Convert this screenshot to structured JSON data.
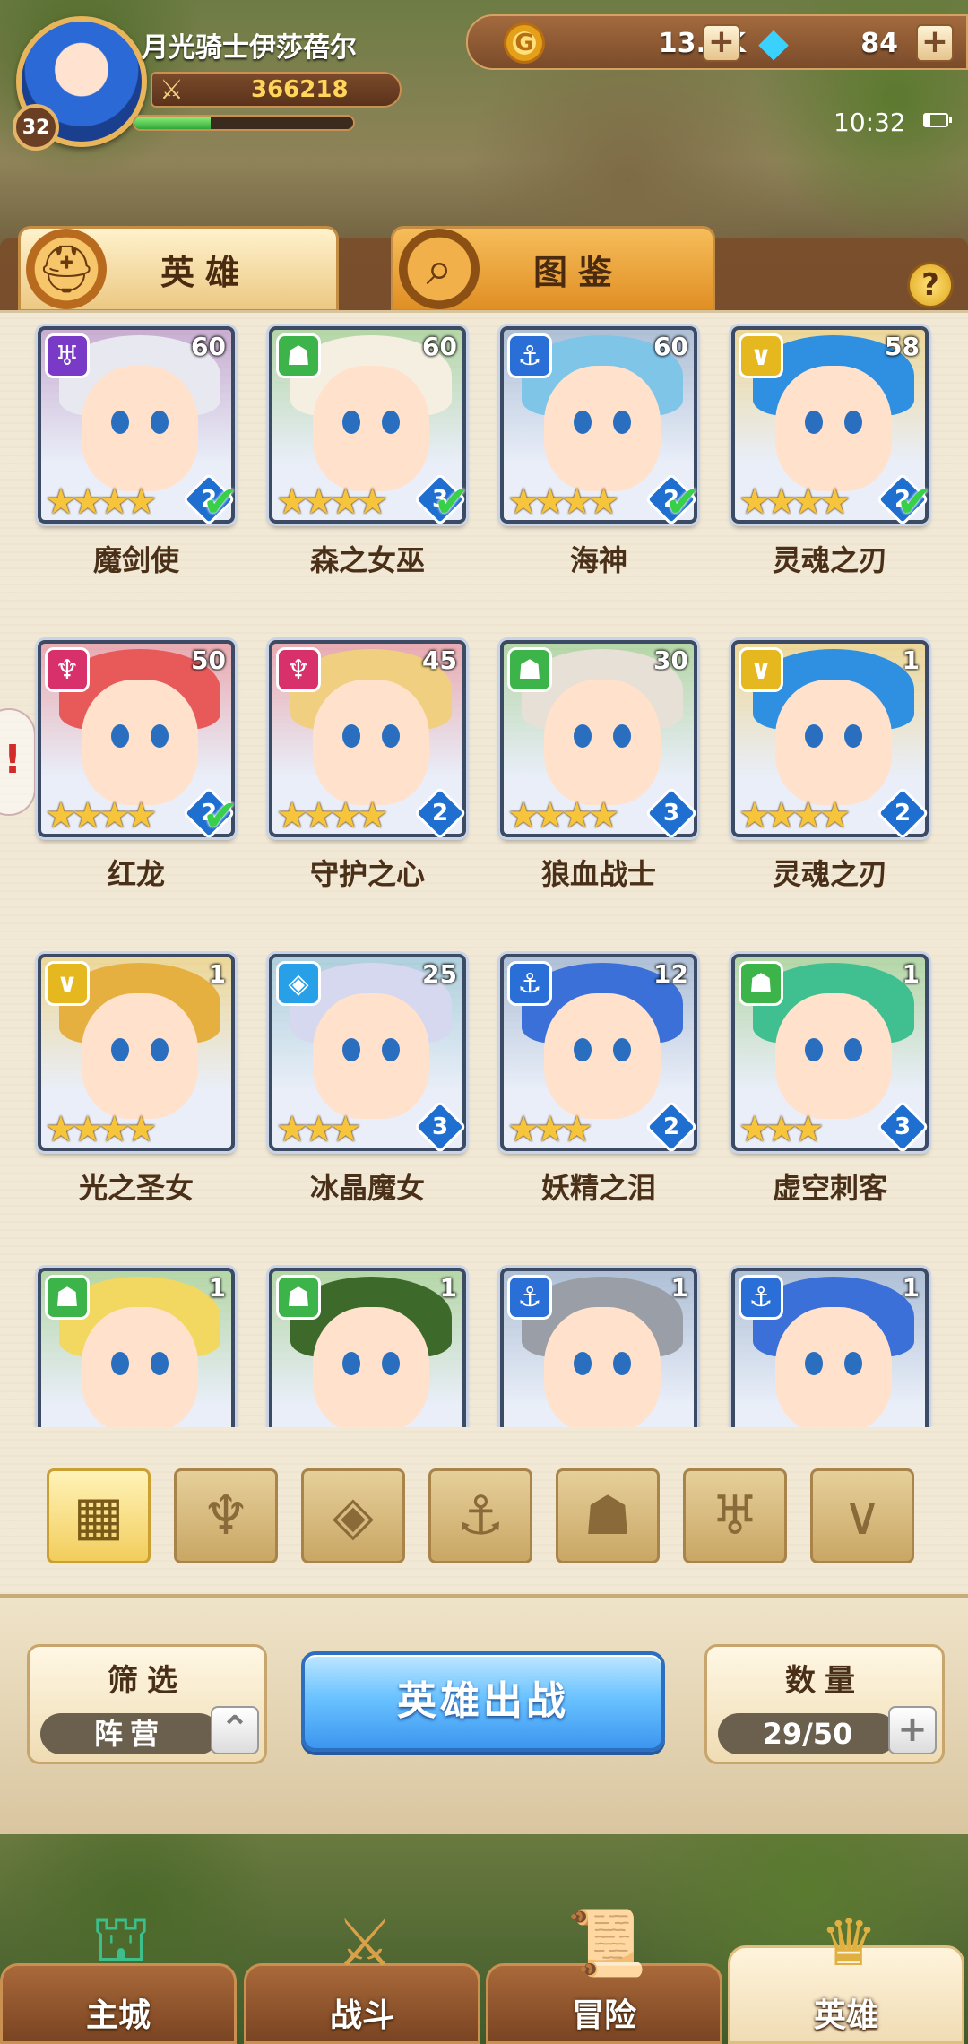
{
  "player": {
    "name": "月光骑士伊莎蓓尔",
    "level": "32",
    "power": "366218",
    "xp_fraction": 0.35
  },
  "currency": {
    "gold": "13.5K",
    "gems": "84"
  },
  "status_bar": {
    "time": "10:32"
  },
  "tabs": [
    {
      "label": "英雄",
      "icon": "knight-helmet-icon"
    },
    {
      "label": "图鉴",
      "icon": "magnifier-book-icon"
    }
  ],
  "help_label": "?",
  "heroes": [
    {
      "name": "魔剑使",
      "level": "60",
      "rank": "2",
      "stars": 4,
      "faction": "dark",
      "faction_color": "#7a3ac8",
      "deployed": true,
      "hair": "#e8e8f0"
    },
    {
      "name": "森之女巫",
      "level": "60",
      "rank": "3",
      "stars": 4,
      "faction": "beast",
      "faction_color": "#3cb44a",
      "deployed": true,
      "hair": "#f4efe0"
    },
    {
      "name": "海神",
      "level": "60",
      "rank": "2",
      "stars": 4,
      "faction": "sea",
      "faction_color": "#2a6fd8",
      "deployed": true,
      "hair": "#7fc5e8"
    },
    {
      "name": "灵魂之刃",
      "level": "58",
      "rank": "2",
      "stars": 4,
      "faction": "light",
      "faction_color": "#e6b820",
      "deployed": true,
      "hair": "#2f8fe0"
    },
    {
      "name": "红龙",
      "level": "50",
      "rank": "2",
      "stars": 4,
      "faction": "fire",
      "faction_color": "#d8306a",
      "deployed": true,
      "hair": "#e85a5a"
    },
    {
      "name": "守护之心",
      "level": "45",
      "rank": "2",
      "stars": 4,
      "faction": "fire",
      "faction_color": "#d8306a",
      "deployed": false,
      "hair": "#f0d080"
    },
    {
      "name": "狼血战士",
      "level": "30",
      "rank": "3",
      "stars": 4,
      "faction": "beast",
      "faction_color": "#3cb44a",
      "deployed": false,
      "hair": "#e6e0d6"
    },
    {
      "name": "灵魂之刃",
      "level": "1",
      "rank": "2",
      "stars": 4,
      "faction": "light",
      "faction_color": "#e6b820",
      "deployed": false,
      "hair": "#2f8fe0"
    },
    {
      "name": "光之圣女",
      "level": "1",
      "rank": "",
      "stars": 4,
      "faction": "light",
      "faction_color": "#e6b820",
      "deployed": false,
      "hair": "#e6b040"
    },
    {
      "name": "冰晶魔女",
      "level": "25",
      "rank": "3",
      "stars": 3,
      "faction": "ice",
      "faction_color": "#28a0e8",
      "deployed": false,
      "hair": "#d6d8f0"
    },
    {
      "name": "妖精之泪",
      "level": "12",
      "rank": "2",
      "stars": 3,
      "faction": "sea",
      "faction_color": "#2a6fd8",
      "deployed": false,
      "hair": "#3a70d8"
    },
    {
      "name": "虚空刺客",
      "level": "1",
      "rank": "3",
      "stars": 3,
      "faction": "beast",
      "faction_color": "#3cb44a",
      "deployed": false,
      "hair": "#40c090"
    },
    {
      "name": "",
      "level": "1",
      "rank": "",
      "stars": 0,
      "faction": "beast",
      "faction_color": "#3cb44a",
      "deployed": false,
      "hair": "#f2d860"
    },
    {
      "name": "",
      "level": "1",
      "rank": "",
      "stars": 0,
      "faction": "beast",
      "faction_color": "#3cb44a",
      "deployed": false,
      "hair": "#3d6a2a"
    },
    {
      "name": "",
      "level": "1",
      "rank": "",
      "stars": 0,
      "faction": "sea",
      "faction_color": "#2a6fd8",
      "deployed": false,
      "hair": "#9a9ea6"
    },
    {
      "name": "",
      "level": "1",
      "rank": "",
      "stars": 0,
      "faction": "sea",
      "faction_color": "#2a6fd8",
      "deployed": false,
      "hair": "#3a70d8"
    }
  ],
  "faction_filters": [
    {
      "icon": "grid-all-icon",
      "glyph": "▦",
      "active": true
    },
    {
      "icon": "fire-faction-icon",
      "glyph": "♆",
      "active": false
    },
    {
      "icon": "ice-faction-icon",
      "glyph": "◈",
      "active": false
    },
    {
      "icon": "anchor-faction-icon",
      "glyph": "⚓",
      "active": false
    },
    {
      "icon": "beast-faction-icon",
      "glyph": "☗",
      "active": false
    },
    {
      "icon": "dark-faction-icon",
      "glyph": "♅",
      "active": false
    },
    {
      "icon": "light-faction-icon",
      "glyph": "∨",
      "active": false
    }
  ],
  "controls": {
    "filter_title": "筛选",
    "filter_value": "阵营",
    "deploy_label": "英雄出战",
    "count_title": "数量",
    "count_value": "29/50"
  },
  "nav": [
    {
      "label": "主城",
      "icon": "city-gate-icon",
      "active": false
    },
    {
      "label": "战斗",
      "icon": "crossed-swords-icon",
      "active": false
    },
    {
      "label": "冒险",
      "icon": "scroll-map-icon",
      "active": false
    },
    {
      "label": "英雄",
      "icon": "hero-crest-icon",
      "active": true
    }
  ]
}
